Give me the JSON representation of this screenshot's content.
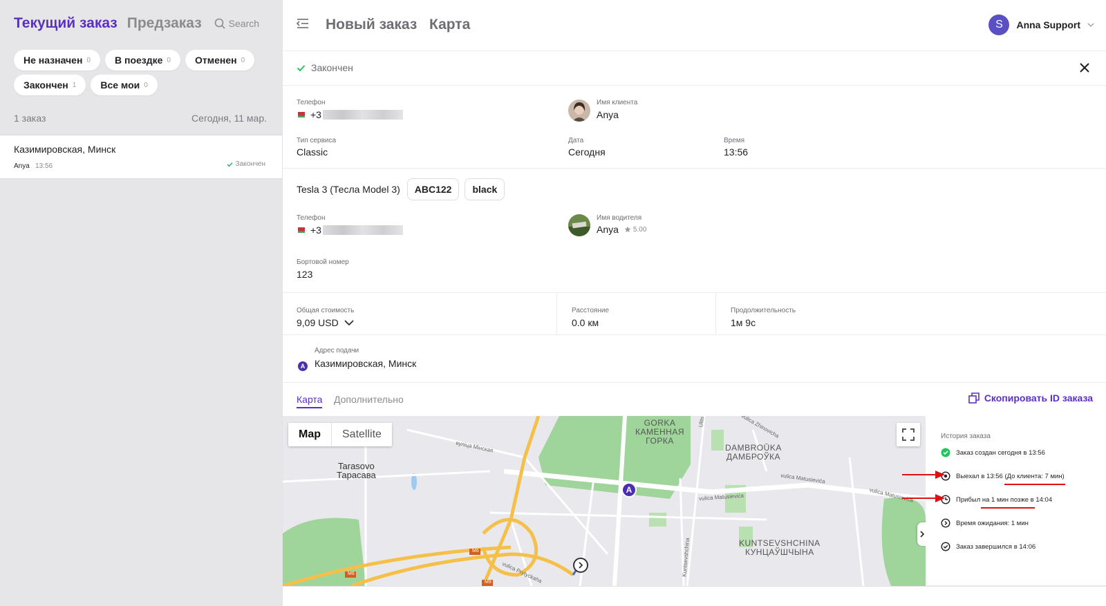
{
  "left": {
    "tab_current": "Текущий заказ",
    "tab_preorder": "Предзаказ",
    "search_label": "Search",
    "chips": [
      {
        "label": "Не назначен",
        "count": "0"
      },
      {
        "label": "В поездке",
        "count": "0"
      },
      {
        "label": "Отменен",
        "count": "0"
      },
      {
        "label": "Закончен",
        "count": "1"
      },
      {
        "label": "Все мои",
        "count": "0"
      }
    ],
    "order_count": "1 заказ",
    "date_label": "Сегодня, 11 мар.",
    "order": {
      "address": "Казимировская, Минск",
      "client": "Anya",
      "time": "13:56",
      "status": "Закончен"
    }
  },
  "header": {
    "title": "Новый заказ",
    "map_link": "Карта",
    "user_initial": "S",
    "user_name": "Anna Support"
  },
  "status": {
    "text": "Закончен",
    "color": "#22c55e"
  },
  "client": {
    "phone_label": "Телефон",
    "phone_prefix": "+3",
    "name_label": "Имя клиента",
    "name": "Anya",
    "service_label": "Тип сервиса",
    "service": "Classic",
    "date_label": "Дата",
    "date": "Сегодня",
    "time_label": "Время",
    "time": "13:56"
  },
  "driver": {
    "car": "Tesla 3 (Тесла Model 3)",
    "plate": "ABC122",
    "color": "black",
    "phone_label": "Телефон",
    "phone_prefix": "+3",
    "name_label": "Имя водителя",
    "name": "Anya",
    "rating": "5.00",
    "board_label": "Бортовой номер",
    "board_number": "123"
  },
  "cost": {
    "total_label": "Общая стоимость",
    "total": "9,09 USD",
    "distance_label": "Расстояние",
    "distance": "0.0 км",
    "duration_label": "Продолжительность",
    "duration": "1м 9с"
  },
  "pickup": {
    "label": "Адрес подачи",
    "marker": "A",
    "address": "Казимировская, Минск"
  },
  "tabs": {
    "map": "Карта",
    "extra": "Дополнительно",
    "copy_id": "Скопировать ID заказа"
  },
  "map": {
    "btn_map": "Map",
    "btn_satellite": "Satellite",
    "pin_label": "A",
    "labels": {
      "gorka": "GORKA\nКАМЕННАЯ\nГОРКА",
      "dambrouka": "DAMBROŪKA\nДАМБРОЎКА",
      "tarasovo": "Tarasovo\nТарасава",
      "kuntsevshchina": "KUNTSEVSHCHINA\nКУНЦАЎШЧЫНА"
    },
    "roads": {
      "minskaya": "вуліца Мінская",
      "matusievica1": "vulica Matusievića",
      "matusievica2": "vulica Matusievića",
      "matusievica3": "vulica Matusievića",
      "zhinovicha": "vulica Zhinovicha",
      "prytyckaha": "vulica Prytyckaha",
      "kuntsevshchina_st": "Kuntsevshchina",
      "m6a": "M6",
      "m6b": "M6",
      "m9": "M9",
      "ulitsa": "Ulits"
    }
  },
  "history": {
    "title": "История заказа",
    "items": [
      {
        "text": "Заказ создан сегодня в 13:56"
      },
      {
        "text": "Выехал в 13:56 (До клиента: 7 мин)"
      },
      {
        "text": "Прибыл на 1 мин позже в 14:04"
      },
      {
        "text": "Время ожидания: 1 мин"
      },
      {
        "text": "Заказ завершился в 14:06"
      }
    ]
  },
  "colors": {
    "accent": "#5b2fc2",
    "annotation": "#e01010"
  }
}
